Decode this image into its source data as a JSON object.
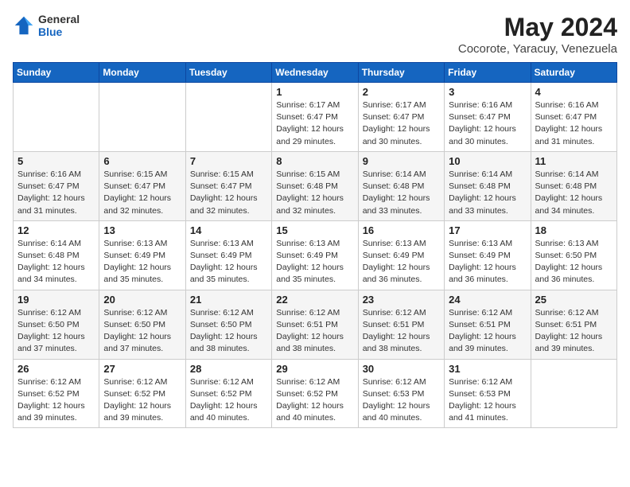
{
  "header": {
    "logo_general": "General",
    "logo_blue": "Blue",
    "month_year": "May 2024",
    "location": "Cocorote, Yaracuy, Venezuela"
  },
  "weekdays": [
    "Sunday",
    "Monday",
    "Tuesday",
    "Wednesday",
    "Thursday",
    "Friday",
    "Saturday"
  ],
  "weeks": [
    [
      {
        "day": "",
        "info": ""
      },
      {
        "day": "",
        "info": ""
      },
      {
        "day": "",
        "info": ""
      },
      {
        "day": "1",
        "info": "Sunrise: 6:17 AM\nSunset: 6:47 PM\nDaylight: 12 hours\nand 29 minutes."
      },
      {
        "day": "2",
        "info": "Sunrise: 6:17 AM\nSunset: 6:47 PM\nDaylight: 12 hours\nand 30 minutes."
      },
      {
        "day": "3",
        "info": "Sunrise: 6:16 AM\nSunset: 6:47 PM\nDaylight: 12 hours\nand 30 minutes."
      },
      {
        "day": "4",
        "info": "Sunrise: 6:16 AM\nSunset: 6:47 PM\nDaylight: 12 hours\nand 31 minutes."
      }
    ],
    [
      {
        "day": "5",
        "info": "Sunrise: 6:16 AM\nSunset: 6:47 PM\nDaylight: 12 hours\nand 31 minutes."
      },
      {
        "day": "6",
        "info": "Sunrise: 6:15 AM\nSunset: 6:47 PM\nDaylight: 12 hours\nand 32 minutes."
      },
      {
        "day": "7",
        "info": "Sunrise: 6:15 AM\nSunset: 6:47 PM\nDaylight: 12 hours\nand 32 minutes."
      },
      {
        "day": "8",
        "info": "Sunrise: 6:15 AM\nSunset: 6:48 PM\nDaylight: 12 hours\nand 32 minutes."
      },
      {
        "day": "9",
        "info": "Sunrise: 6:14 AM\nSunset: 6:48 PM\nDaylight: 12 hours\nand 33 minutes."
      },
      {
        "day": "10",
        "info": "Sunrise: 6:14 AM\nSunset: 6:48 PM\nDaylight: 12 hours\nand 33 minutes."
      },
      {
        "day": "11",
        "info": "Sunrise: 6:14 AM\nSunset: 6:48 PM\nDaylight: 12 hours\nand 34 minutes."
      }
    ],
    [
      {
        "day": "12",
        "info": "Sunrise: 6:14 AM\nSunset: 6:48 PM\nDaylight: 12 hours\nand 34 minutes."
      },
      {
        "day": "13",
        "info": "Sunrise: 6:13 AM\nSunset: 6:49 PM\nDaylight: 12 hours\nand 35 minutes."
      },
      {
        "day": "14",
        "info": "Sunrise: 6:13 AM\nSunset: 6:49 PM\nDaylight: 12 hours\nand 35 minutes."
      },
      {
        "day": "15",
        "info": "Sunrise: 6:13 AM\nSunset: 6:49 PM\nDaylight: 12 hours\nand 35 minutes."
      },
      {
        "day": "16",
        "info": "Sunrise: 6:13 AM\nSunset: 6:49 PM\nDaylight: 12 hours\nand 36 minutes."
      },
      {
        "day": "17",
        "info": "Sunrise: 6:13 AM\nSunset: 6:49 PM\nDaylight: 12 hours\nand 36 minutes."
      },
      {
        "day": "18",
        "info": "Sunrise: 6:13 AM\nSunset: 6:50 PM\nDaylight: 12 hours\nand 36 minutes."
      }
    ],
    [
      {
        "day": "19",
        "info": "Sunrise: 6:12 AM\nSunset: 6:50 PM\nDaylight: 12 hours\nand 37 minutes."
      },
      {
        "day": "20",
        "info": "Sunrise: 6:12 AM\nSunset: 6:50 PM\nDaylight: 12 hours\nand 37 minutes."
      },
      {
        "day": "21",
        "info": "Sunrise: 6:12 AM\nSunset: 6:50 PM\nDaylight: 12 hours\nand 38 minutes."
      },
      {
        "day": "22",
        "info": "Sunrise: 6:12 AM\nSunset: 6:51 PM\nDaylight: 12 hours\nand 38 minutes."
      },
      {
        "day": "23",
        "info": "Sunrise: 6:12 AM\nSunset: 6:51 PM\nDaylight: 12 hours\nand 38 minutes."
      },
      {
        "day": "24",
        "info": "Sunrise: 6:12 AM\nSunset: 6:51 PM\nDaylight: 12 hours\nand 39 minutes."
      },
      {
        "day": "25",
        "info": "Sunrise: 6:12 AM\nSunset: 6:51 PM\nDaylight: 12 hours\nand 39 minutes."
      }
    ],
    [
      {
        "day": "26",
        "info": "Sunrise: 6:12 AM\nSunset: 6:52 PM\nDaylight: 12 hours\nand 39 minutes."
      },
      {
        "day": "27",
        "info": "Sunrise: 6:12 AM\nSunset: 6:52 PM\nDaylight: 12 hours\nand 39 minutes."
      },
      {
        "day": "28",
        "info": "Sunrise: 6:12 AM\nSunset: 6:52 PM\nDaylight: 12 hours\nand 40 minutes."
      },
      {
        "day": "29",
        "info": "Sunrise: 6:12 AM\nSunset: 6:52 PM\nDaylight: 12 hours\nand 40 minutes."
      },
      {
        "day": "30",
        "info": "Sunrise: 6:12 AM\nSunset: 6:53 PM\nDaylight: 12 hours\nand 40 minutes."
      },
      {
        "day": "31",
        "info": "Sunrise: 6:12 AM\nSunset: 6:53 PM\nDaylight: 12 hours\nand 41 minutes."
      },
      {
        "day": "",
        "info": ""
      }
    ]
  ]
}
